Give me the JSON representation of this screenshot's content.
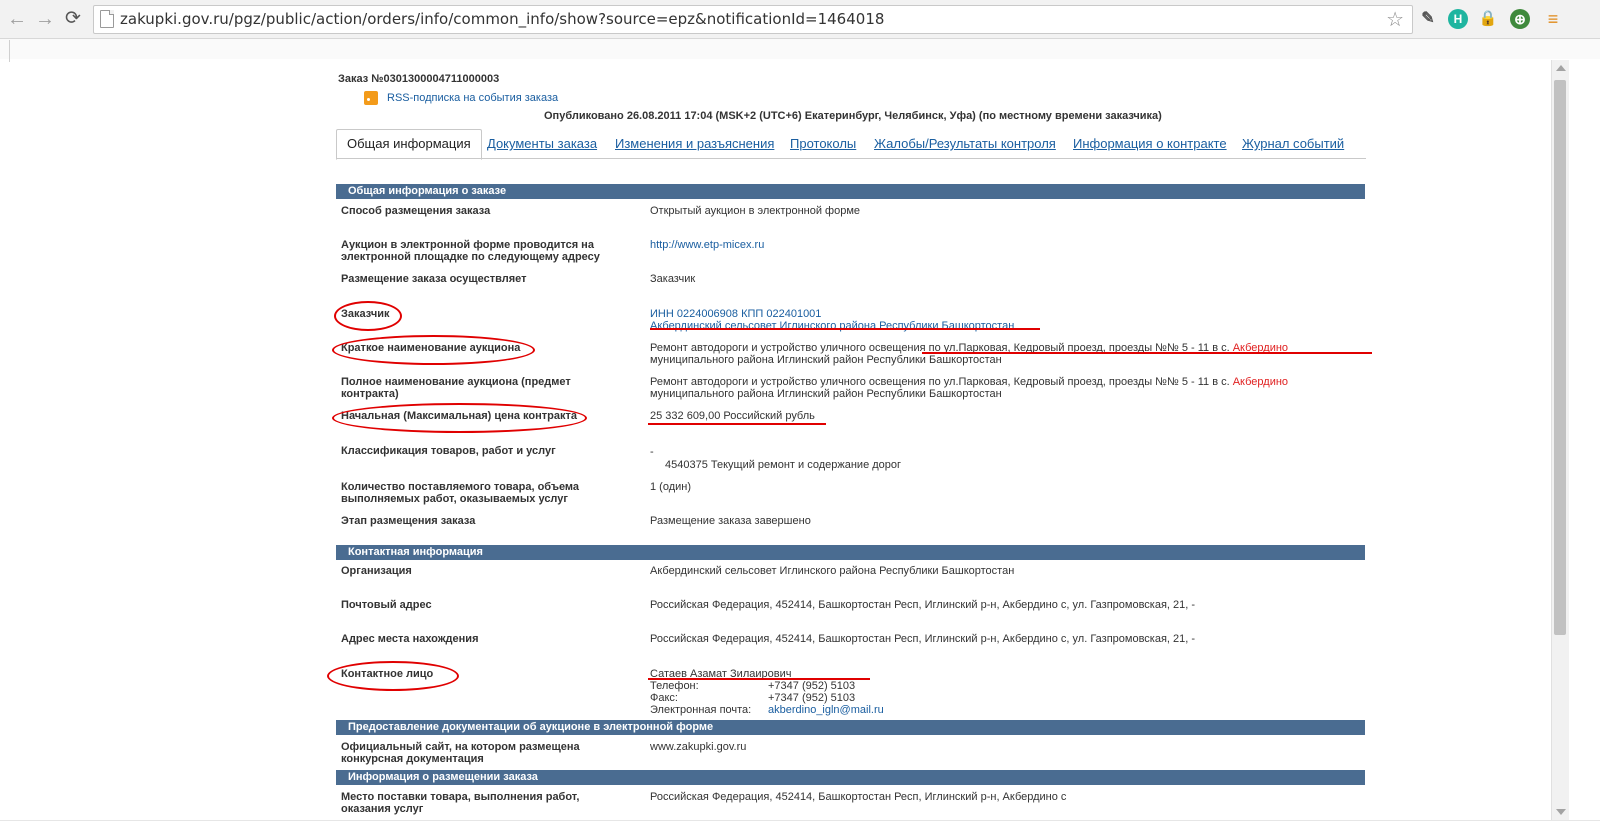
{
  "browser": {
    "url": "zakupki.gov.ru/pgz/public/action/orders/info/common_info/show?source=epz&notificationId=1464018",
    "extensions": [
      "bookmark-icon",
      "h-icon",
      "lock-icon",
      "globe-icon",
      "menu-icon"
    ]
  },
  "header": {
    "order_title": "Заказ №0301300004711000003",
    "rss_label": "RSS-подписка на события заказа",
    "published": "Опубликовано 26.08.2011 17:04 (MSK+2 (UTC+6) Екатеринбург, Челябинск, Уфа) (по местному времени заказчика)"
  },
  "tabs": [
    {
      "label": "Общая информация"
    },
    {
      "label": "Документы заказа"
    },
    {
      "label": "Изменения и разъяснения"
    },
    {
      "label": "Протоколы"
    },
    {
      "label": "Жалобы/Результаты контроля"
    },
    {
      "label": "Информация о контракте"
    },
    {
      "label": "Журнал событий"
    }
  ],
  "sections": {
    "general": "Общая информация о заказе",
    "contact": "Контактная информация",
    "docs": "Предоставление документации об аукционе в электронной форме",
    "placement": "Информация о размещении заказа"
  },
  "general": {
    "method_label": "Способ размещения заказа",
    "method_value": "Открытый аукцион в электронной форме",
    "platform_label": "Аукцион в электронной форме проводится на электронной площадке по следующему адресу",
    "platform_value": "http://www.etp-micex.ru",
    "placer_label": "Размещение заказа осуществляет",
    "placer_value": "Заказчик",
    "customer_label": "Заказчик",
    "customer_inn": "ИНН 0224006908 КПП 022401001",
    "customer_name": "Акбердинский сельсовет Иглинского района Республики Башкортостан",
    "short_name_label": "Краткое наименование аукциона",
    "short_name_value_1": "Ремонт автодороги и устройство уличного освещения по ул.Парковая, Кедровый проезд, проезды №№ 5 - 11 в с.",
    "short_name_red": "Акбердино",
    "short_name_value_2": "муниципального района Иглинский район Республики Башкортостан",
    "full_name_label": "Полное наименование аукциона (предмет контракта)",
    "full_name_value_1": "Ремонт автодороги и устройство уличного освещения по ул.Парковая, Кедровый проезд, проезды №№ 5 - 11 в с.",
    "full_name_red": "Акбердино",
    "full_name_value_2": "муниципального района Иглинский район Республики Башкортостан",
    "price_label": "Начальная (Максимальная) цена контракта",
    "price_value": "25 332 609,00 Российский рубль",
    "class_label": "Классификация товаров, работ и услуг",
    "class_dash": "-",
    "class_value": "4540375 Текущий ремонт и содержание дорог",
    "qty_label": "Количество поставляемого товара, объема выполняемых работ, оказываемых услуг",
    "qty_value": "1 (один)",
    "stage_label": "Этап размещения заказа",
    "stage_value": "Размещение заказа завершено"
  },
  "contact": {
    "org_label": "Организация",
    "org_value": "Акбердинский сельсовет Иглинского района Республики Башкортостан",
    "postal_label": "Почтовый адрес",
    "postal_value": "Российская Федерация, 452414, Башкортостан Респ, Иглинский р-н, Акбердино с, ул. Газпромовская, 21, -",
    "location_label": "Адрес места нахождения",
    "location_value": "Российская Федерация, 452414, Башкортостан Респ, Иглинский р-н, Акбердино с, ул. Газпромовская, 21, -",
    "person_label": "Контактное лицо",
    "person_name": "Сатаев Азамат Зилаирович",
    "phone_label": "Телефон:",
    "phone_value": "+7347 (952) 5103",
    "fax_label": "Факс:",
    "fax_value": "+7347 (952) 5103",
    "email_label": "Электронная почта:",
    "email_value": "akberdino_igln@mail.ru"
  },
  "docs": {
    "site_label": "Официальный сайт, на котором размещена конкурсная документация",
    "site_value": "www.zakupki.gov.ru"
  },
  "placement": {
    "delivery_label": "Место поставки товара, выполнения работ, оказания услуг",
    "delivery_value": "Российская Федерация, 452414, Башкортостан Респ, Иглинский р-н, Акбердино с"
  },
  "colors": {
    "section_header": "#4a6c91",
    "link": "#1a5ea0",
    "annotation": "#e00000"
  }
}
